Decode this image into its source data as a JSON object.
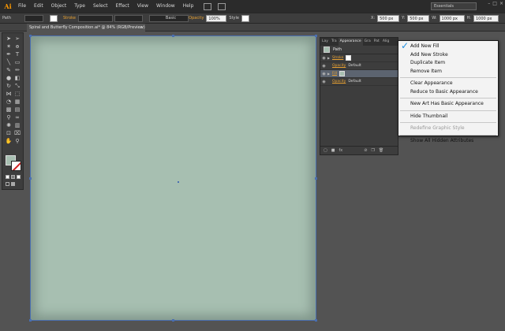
{
  "app": {
    "logo": "Ai"
  },
  "menu": [
    "File",
    "Edit",
    "Object",
    "Type",
    "Select",
    "Effect",
    "View",
    "Window",
    "Help"
  ],
  "workspace": "Essentials",
  "window_buttons": [
    "–",
    "□",
    "×"
  ],
  "controlbar": {
    "selection_label": "Path",
    "stroke_label": "Stroke",
    "brush_label": "Basic",
    "opacity_label": "Opacity",
    "opacity_value": "100%",
    "style_label": "Style",
    "x_label": "X:",
    "x_value": "500 px",
    "y_label": "Y:",
    "y_value": "500 px",
    "w_label": "W:",
    "w_value": "1000 px",
    "h_label": "H:",
    "h_value": "1000 px"
  },
  "document": {
    "tab_title": "Spiral and Butterfly Composition.ai* @ 84% (RGB/Preview)",
    "close": "×"
  },
  "colors": {
    "fill": "#a7bfb1",
    "accent": "#e8a030",
    "selection": "#4a6fb0",
    "check": "#1f8fe0"
  },
  "appearance_panel": {
    "tabs": [
      "Lay",
      "Tra",
      "Appearance",
      "Gra",
      "Pat",
      "Alig"
    ],
    "header": "Path",
    "rows": [
      {
        "label": "Stroke",
        "value": ""
      },
      {
        "label": "Opacity",
        "value": "Default"
      },
      {
        "label": "Fill",
        "value": ""
      },
      {
        "label": "Opacity",
        "value": "Default"
      }
    ],
    "footer_fx": "fx"
  },
  "flyout_menu": {
    "items": [
      {
        "label": "Add New Fill",
        "checked": true
      },
      {
        "label": "Add New Stroke"
      },
      {
        "label": "Duplicate Item"
      },
      {
        "label": "Remove Item"
      },
      {
        "label": "Clear Appearance"
      },
      {
        "label": "Reduce to Basic Appearance"
      },
      {
        "label": "New Art Has Basic Appearance"
      },
      {
        "label": "Hide Thumbnail"
      },
      {
        "label": "Redefine Graphic Style",
        "disabled": true
      },
      {
        "label": "Show All Hidden Attributes"
      }
    ]
  }
}
